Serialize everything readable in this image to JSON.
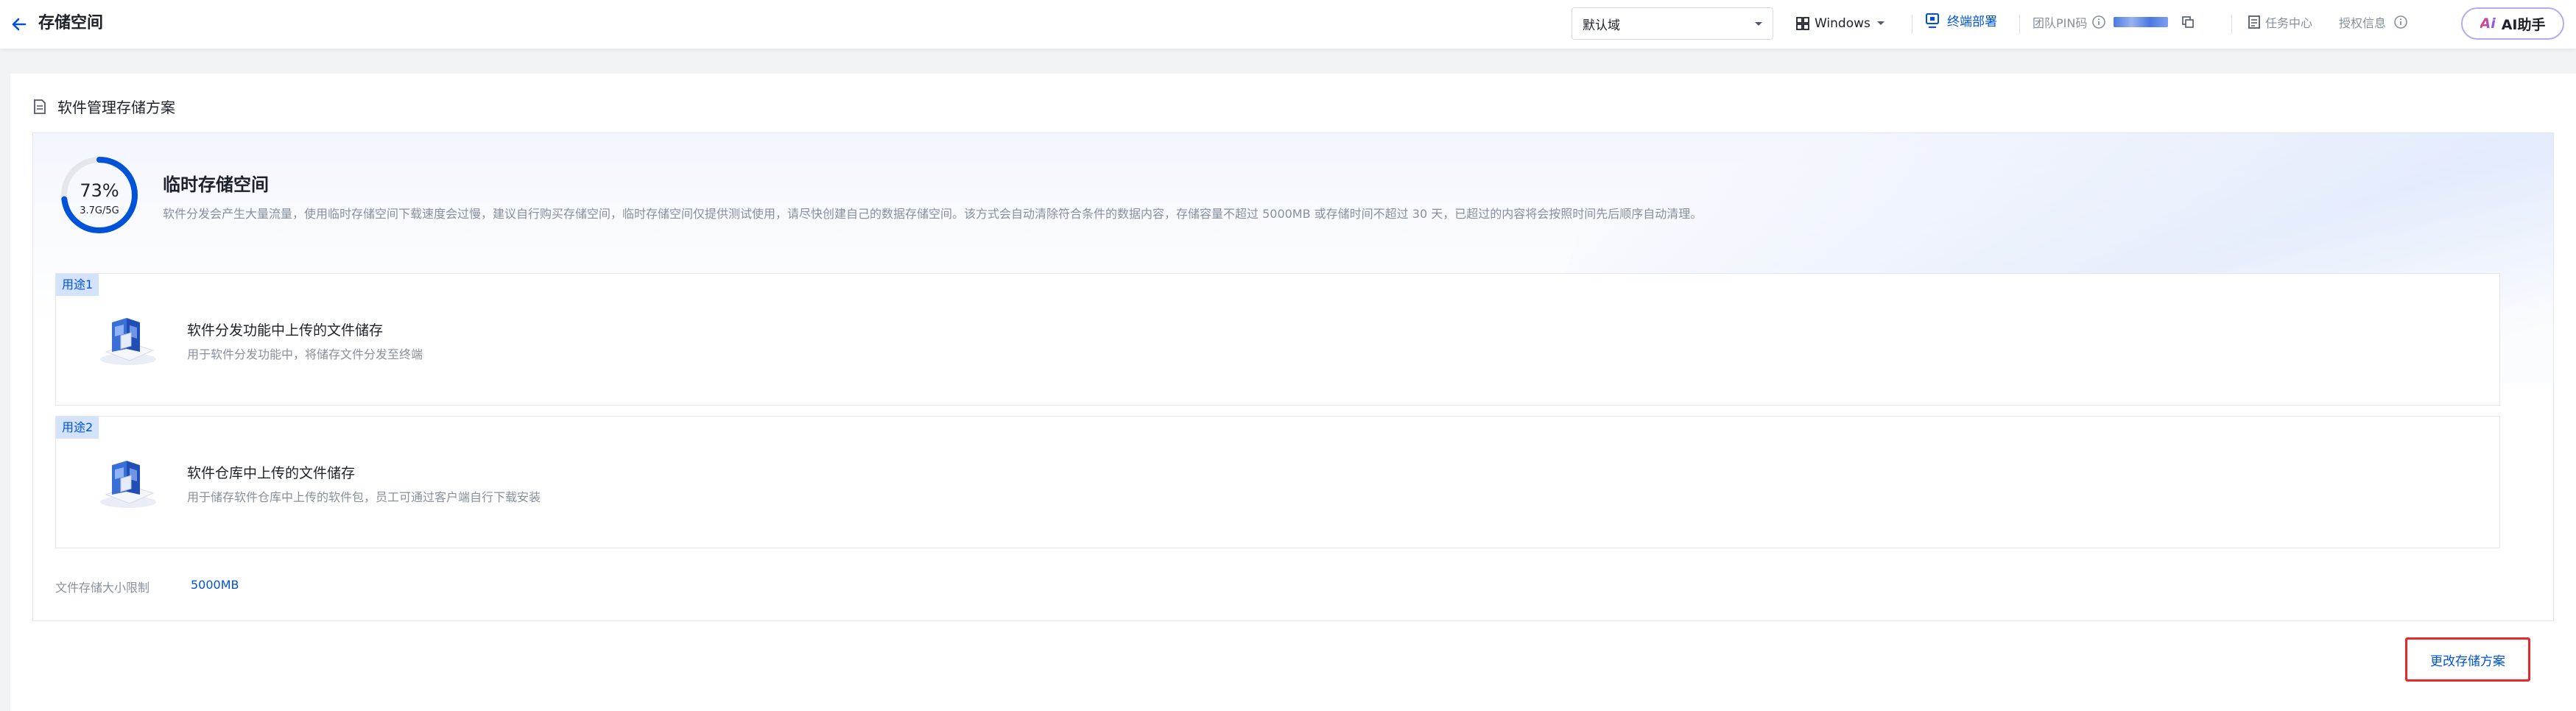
{
  "header": {
    "title": "存储空间",
    "domain_select": {
      "value": "默认域"
    },
    "os_select": {
      "value": "Windows"
    },
    "terminal_deploy_label": "终端部署",
    "pin_label": "团队PIN码",
    "task_center_label": "任务中心",
    "auth_info_label": "授权信息",
    "ai_assistant": {
      "logo_text": "Ai",
      "label": "AI助手"
    }
  },
  "section": {
    "title": "软件管理存储方案"
  },
  "temp_storage": {
    "percent_text": "73%",
    "usage_text": "3.7G/5G",
    "usage_fraction": 0.73,
    "title": "临时存储空间",
    "description": "软件分发会产生大量流量，使用临时存储空间下载速度会过慢，建议自行购买存储空间，临时存储空间仅提供测试使用，请尽快创建自己的数据存储空间。该方式会自动清除符合条件的数据内容，存储容量不超过 5000MB 或存储时间不超过 30 天，已超过的内容将会按照时间先后顺序自动清理。"
  },
  "usages": [
    {
      "tag": "用途1",
      "title": "软件分发功能中上传的文件储存",
      "desc": "用于软件分发功能中，将储存文件分发至终端"
    },
    {
      "tag": "用途2",
      "title": "软件仓库中上传的文件储存",
      "desc": "用于储存软件仓库中上传的软件包，员工可通过客户端自行下载安装"
    }
  ],
  "limit": {
    "label": "文件存储大小限制",
    "value": "5000MB"
  },
  "change_plan_label": "更改存储方案",
  "colors": {
    "primary": "#0052d9",
    "highlight_border": "#e8282b",
    "ring": "#0052d9",
    "muted_text": "#86909c"
  }
}
